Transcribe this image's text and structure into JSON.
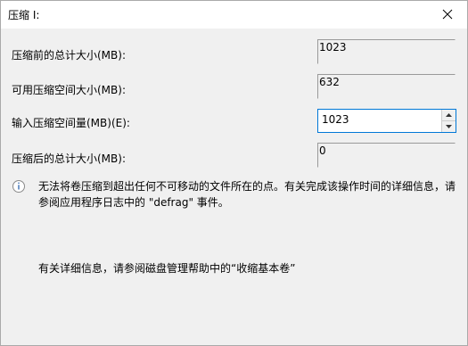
{
  "window": {
    "title": "压缩 I:"
  },
  "fields": [
    {
      "label": "压缩前的总计大小(MB):",
      "value": "1023"
    },
    {
      "label": "可用压缩空间大小(MB):",
      "value": "632"
    },
    {
      "label": "输入压缩空间量(MB)(E):",
      "value": "1023"
    },
    {
      "label": "压缩后的总计大小(MB):",
      "value": "0"
    }
  ],
  "info": {
    "text": "无法将卷压缩到超出任何不可移动的文件所在的点。有关完成该操作时间的详细信息，请参阅应用程序日志中的 \"defrag\" 事件。"
  },
  "help": {
    "text": "有关详细信息，请参阅磁盘管理帮助中的“收缩基本卷”"
  },
  "icons": {
    "close": "close-icon",
    "info": "info-icon",
    "spin_up": "chevron-up-icon",
    "spin_down": "chevron-down-icon"
  }
}
